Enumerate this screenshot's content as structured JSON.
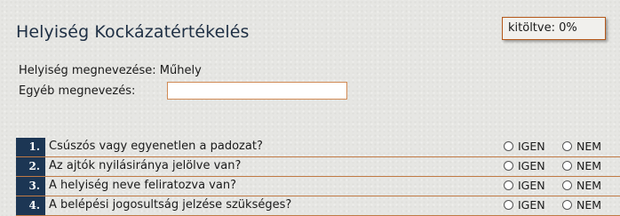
{
  "page": {
    "title": "Helyiség Kockázatértékelés"
  },
  "progress": {
    "label": "kitöltve: 0%",
    "value_percent": 0
  },
  "fields": {
    "room_name_label": "Helyiség megnevezése: Műhely",
    "other_name_label": "Egyéb megnevezés:",
    "other_name_value": ""
  },
  "options": {
    "yes": "IGEN",
    "no": "NEM"
  },
  "questions": [
    {
      "number": "1.",
      "text": "Csúszós vagy egyenetlen a padozat?"
    },
    {
      "number": "2.",
      "text": "Az ajtók nyilásiránya jelölve van?"
    },
    {
      "number": "3.",
      "text": "A helyiség neve feliratozva van?"
    },
    {
      "number": "4.",
      "text": "A belépési jogosultság jelzése szükséges?"
    }
  ]
}
